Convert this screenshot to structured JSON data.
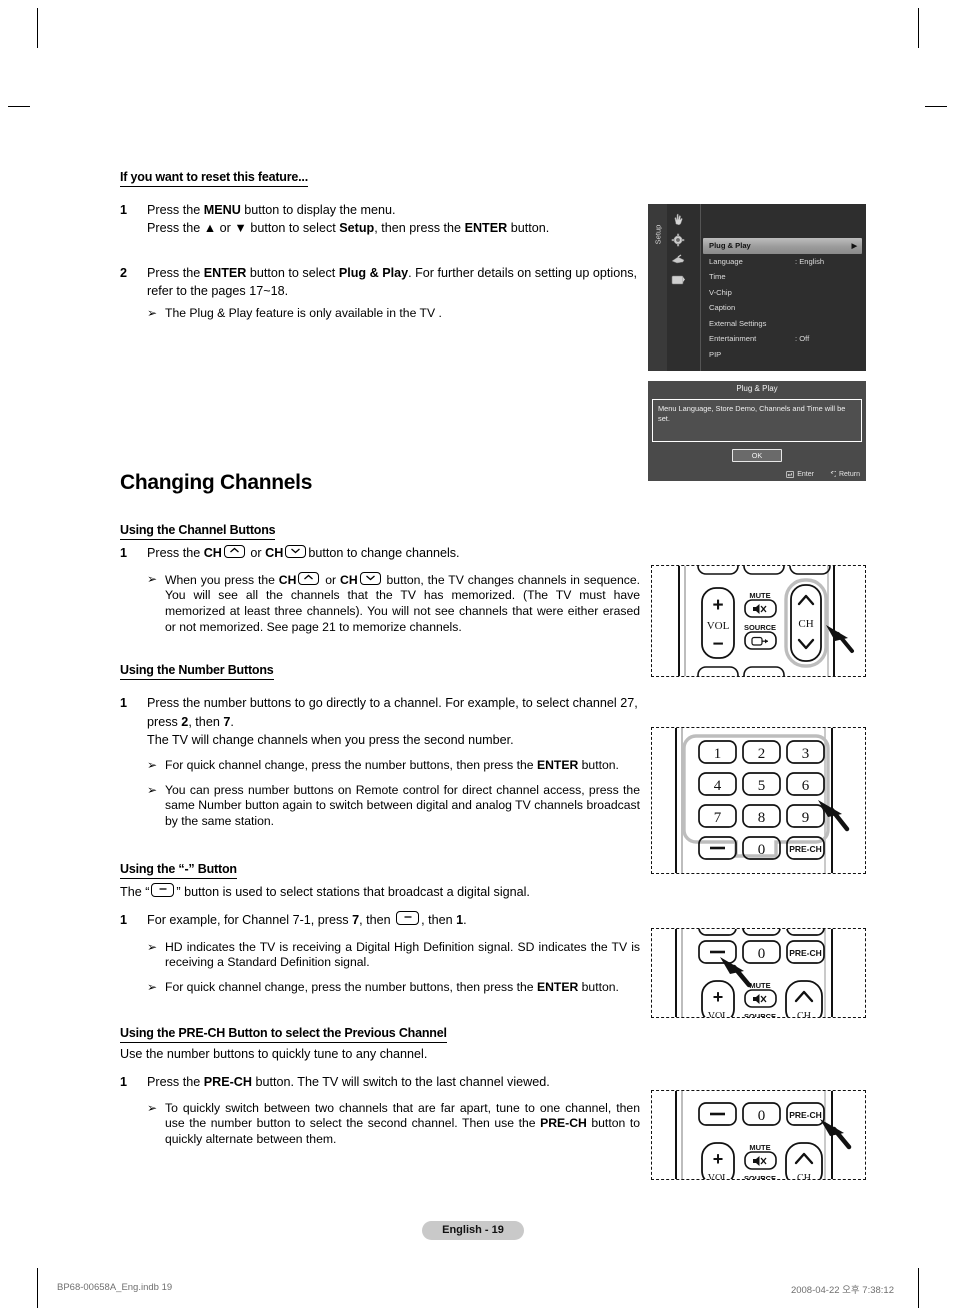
{
  "document": {
    "page_badge": "English - 19",
    "footer_left": "BP68-00658A_Eng.indb   19",
    "footer_right": "2008-04-22   오후 7:38:12"
  },
  "reset_section": {
    "heading": "If you want to reset this feature...",
    "steps": [
      {
        "num": "1",
        "line1_a": "Press the ",
        "line1_b": "MENU",
        "line1_c": " button to display the menu.",
        "line2_a": "Press the ",
        "line2_b": "▲",
        "line2_c": " or ",
        "line2_d": "▼",
        "line2_e": " button to select ",
        "line2_f": "Setup",
        "line2_g": ", then press the ",
        "line2_h": "ENTER",
        "line2_i": " button."
      },
      {
        "num": "2",
        "line1_a": "Press the ",
        "line1_b": "ENTER",
        "line1_c": " button to select ",
        "line1_d": "Plug & Play",
        "line1_e": ". For further details on setting up options, refer to the pages 17~18.",
        "bullet": "The Plug & Play feature is only available in the TV ."
      }
    ]
  },
  "osd_menu": {
    "side_label": "Setup",
    "icons": [
      "hand-pointer-icon",
      "gear-icon",
      "antenna-icon",
      "screen-icon"
    ],
    "rows": [
      {
        "label": "Plug & Play",
        "value": "",
        "active": true,
        "arrow": "▶"
      },
      {
        "label": "Language",
        "value": ": English",
        "active": false
      },
      {
        "label": "Time",
        "value": "",
        "active": false
      },
      {
        "label": "V-Chip",
        "value": "",
        "active": false
      },
      {
        "label": "Caption",
        "value": "",
        "active": false
      },
      {
        "label": "External Settings",
        "value": "",
        "active": false
      },
      {
        "label": "Entertainment",
        "value": ": Off",
        "active": false
      },
      {
        "label": "PIP",
        "value": "",
        "active": false
      }
    ]
  },
  "plug_play_dialog": {
    "title": "Plug & Play",
    "message": "Menu Language, Store Demo, Channels and Time will be set.",
    "ok_label": "OK",
    "enter_label": "Enter",
    "return_label": "Return"
  },
  "chapter": {
    "title": "Changing Channels"
  },
  "channel_buttons": {
    "heading": "Using the Channel Buttons",
    "step_num": "1",
    "step_a": "Press the ",
    "step_b": "CH",
    "step_c": " or ",
    "step_d": "CH",
    "step_e": "button to change channels.",
    "bullet_a": "When you press the ",
    "bullet_b": "CH",
    "bullet_c": " or ",
    "bullet_d": "CH",
    "bullet_e": " button, the TV changes channels in sequence. You will see all the channels that the TV has memorized. (The TV must have memorized at least three channels). You will not see channels that were either erased or not memorized. See page 21 to memorize channels."
  },
  "number_buttons": {
    "heading": "Using the Number Buttons",
    "step_num": "1",
    "step_a": "Press the number buttons to go directly to a channel. For example, to select channel 27, press ",
    "step_b": "2",
    "step_c": ", then ",
    "step_d": "7",
    "step_e": ".",
    "step_f": "The TV will change channels when you press the second number.",
    "bullet1_a": "For quick channel change, press the number buttons, then press the ",
    "bullet1_b": "ENTER",
    "bullet1_c": " button.",
    "bullet2": "You can press number buttons on Remote control for direct channel access, press the same Number button again to switch between digital and analog TV channels broadcast by the same station."
  },
  "dash_button": {
    "heading": "Using the “-” Button",
    "intro_a": "The “",
    "intro_b": "” button is used to select stations that broadcast a digital signal.",
    "step_num": "1",
    "step_a": "For example, for Channel 7-1, press ",
    "step_b": "7",
    "step_c": ", then ",
    "step_d": ", then ",
    "step_e": "1",
    "step_f": ".",
    "bullet1": "HD indicates the TV is receiving a Digital High Definition signal. SD indicates the TV is receiving a Standard Definition signal.",
    "bullet2_a": "For quick channel change, press the number buttons, then press the ",
    "bullet2_b": "ENTER",
    "bullet2_c": " button."
  },
  "prech_button": {
    "heading": "Using the PRE-CH Button to select the Previous Channel",
    "intro": "Use the number buttons to quickly tune to any channel.",
    "step_num": "1",
    "step_a": "Press the ",
    "step_b": "PRE-CH",
    "step_c": " button. The TV will switch to the last channel viewed.",
    "bullet_a": "To quickly switch between two channels that are far apart, tune to one channel, then use the number button to select the second channel. Then use the ",
    "bullet_b": "PRE-CH",
    "bullet_c": " button to quickly alternate between them."
  },
  "remote_diagrams": {
    "ch_rocker": {
      "vol_label": "VOL",
      "vol_plus": "+",
      "vol_minus": "−",
      "mute_label": "MUTE",
      "source_label": "SOURCE",
      "ch_label": "CH"
    },
    "keypad": {
      "keys": [
        "1",
        "2",
        "3",
        "4",
        "5",
        "6",
        "7",
        "8",
        "9"
      ],
      "dash": "−",
      "zero": "0",
      "prech": "PRE-CH"
    },
    "dash_row": {
      "dash": "−",
      "zero": "0",
      "prech": "PRE-CH",
      "vol_plus": "+",
      "vol_label": "VOL",
      "mute_label": "MUTE",
      "source_label": "SOURCE",
      "ch_label": "CH"
    },
    "prech_row": {
      "dash": "−",
      "zero": "0",
      "prech": "PRE-CH",
      "vol_plus": "+",
      "vol_label": "VOL",
      "mute_label": "MUTE",
      "source_label": "SOURCE",
      "ch_label": "CH"
    }
  }
}
